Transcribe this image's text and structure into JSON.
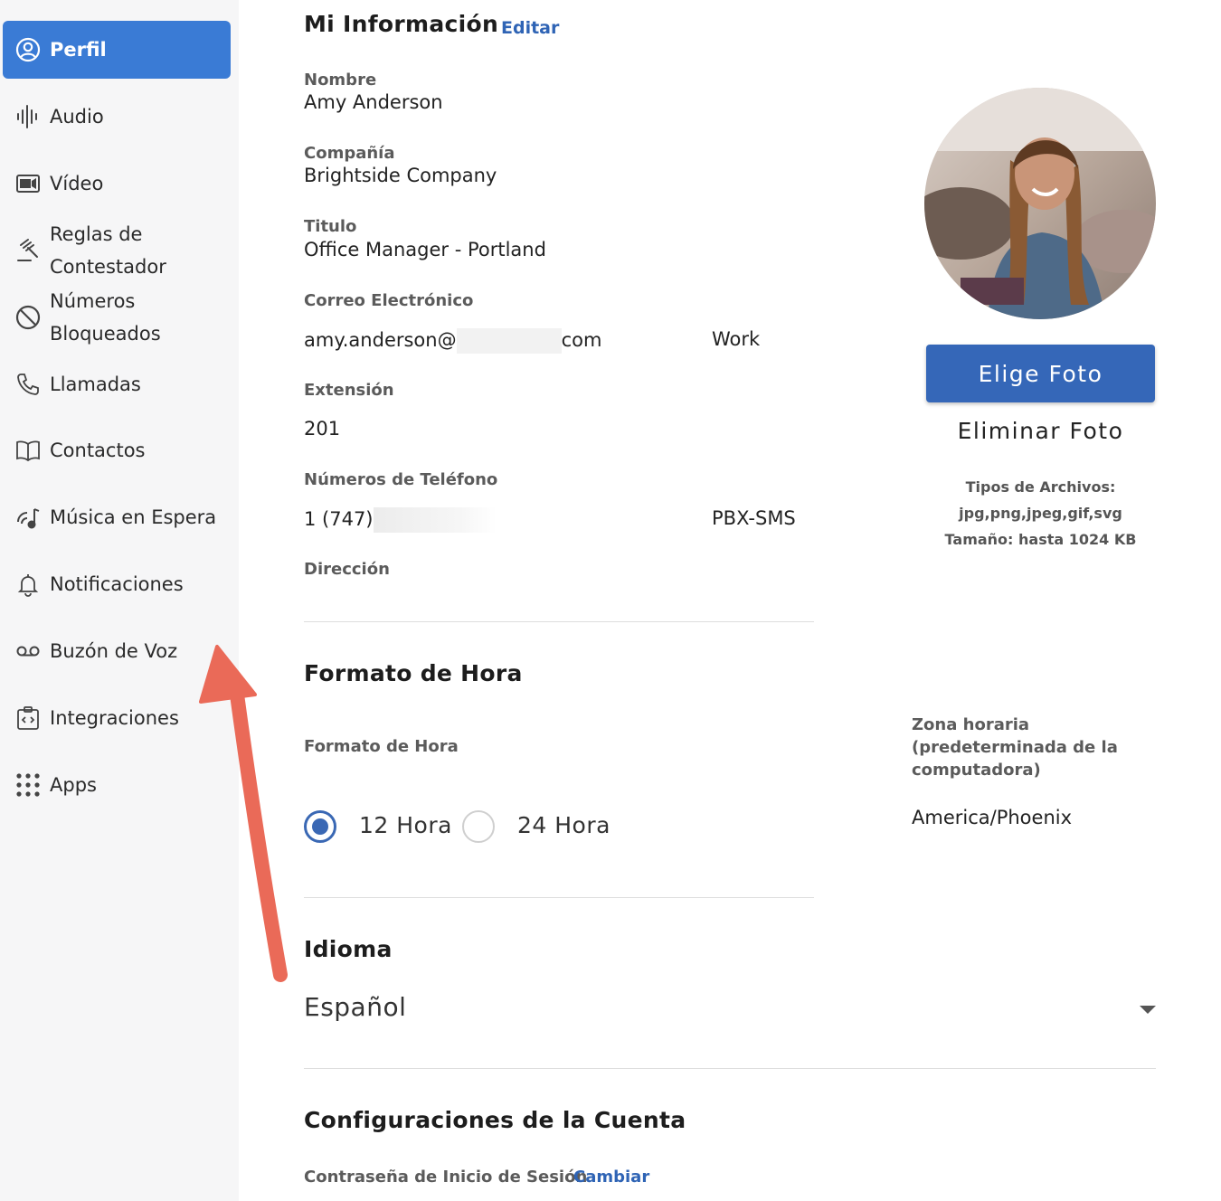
{
  "sidebar": {
    "items": [
      {
        "label": "Perfil",
        "icon": "profile-icon"
      },
      {
        "label": "Audio",
        "icon": "waveform-icon"
      },
      {
        "label": "Vídeo",
        "icon": "video-icon"
      },
      {
        "label": "Reglas de Contestador",
        "icon": "gavel-icon"
      },
      {
        "label": "Números Bloqueados",
        "icon": "blocked-icon"
      },
      {
        "label": "Llamadas",
        "icon": "phone-icon"
      },
      {
        "label": "Contactos",
        "icon": "book-icon"
      },
      {
        "label": "Música en Espera",
        "icon": "music-icon"
      },
      {
        "label": "Notificaciones",
        "icon": "bell-icon"
      },
      {
        "label": "Buzón de Voz",
        "icon": "voicemail-icon"
      },
      {
        "label": "Integraciones",
        "icon": "integration-icon"
      },
      {
        "label": "Apps",
        "icon": "grid-icon"
      }
    ],
    "item_lines": {
      "reglas_1": "Reglas de",
      "reglas_2": "Contestador",
      "numeros_1": "Números",
      "numeros_2": "Bloqueados"
    }
  },
  "info": {
    "title": "Mi Información",
    "edit_link": "Editar",
    "name_label": "Nombre",
    "name_value": "Amy Anderson",
    "company_label": "Compañía",
    "company_value": "Brightside Company",
    "title_label": "Titulo",
    "title_value": "Office Manager - Portland",
    "email_label": "Correo Electrónico",
    "email_prefix": "amy.anderson@",
    "email_suffix": "com",
    "email_type": "Work",
    "ext_label": "Extensión",
    "ext_value": "201",
    "phone_label": "Números de Teléfono",
    "phone_prefix": "1 (747)",
    "phone_type": "PBX-SMS",
    "address_label": "Dirección"
  },
  "photo": {
    "choose_button": "Elige Foto",
    "remove_button": "Eliminar Foto",
    "file_types_label": "Tipos de Archivos:",
    "file_types": "jpg,png,jpeg,gif,svg",
    "size_limit": "Tamaño: hasta 1024 KB"
  },
  "time_format": {
    "section_title": "Formato de Hora",
    "field_label": "Formato de Hora",
    "option_12": "12 Hora",
    "option_24": "24 Hora",
    "selected": "12 Hora",
    "timezone_label_1": "Zona horaria",
    "timezone_label_2": "(predeterminada de la",
    "timezone_label_3": "computadora)",
    "timezone_value": "America/Phoenix"
  },
  "language": {
    "section_title": "Idioma",
    "selected": "Español"
  },
  "account": {
    "section_title": "Configuraciones de la Cuenta",
    "password_label": "Contraseña de Inicio de Sesión",
    "change_link": "Cambiar"
  },
  "colors": {
    "accent": "#3a7bd5",
    "button": "#3567b8",
    "link": "#2f64b5",
    "annotation_arrow": "#ea6a58"
  }
}
